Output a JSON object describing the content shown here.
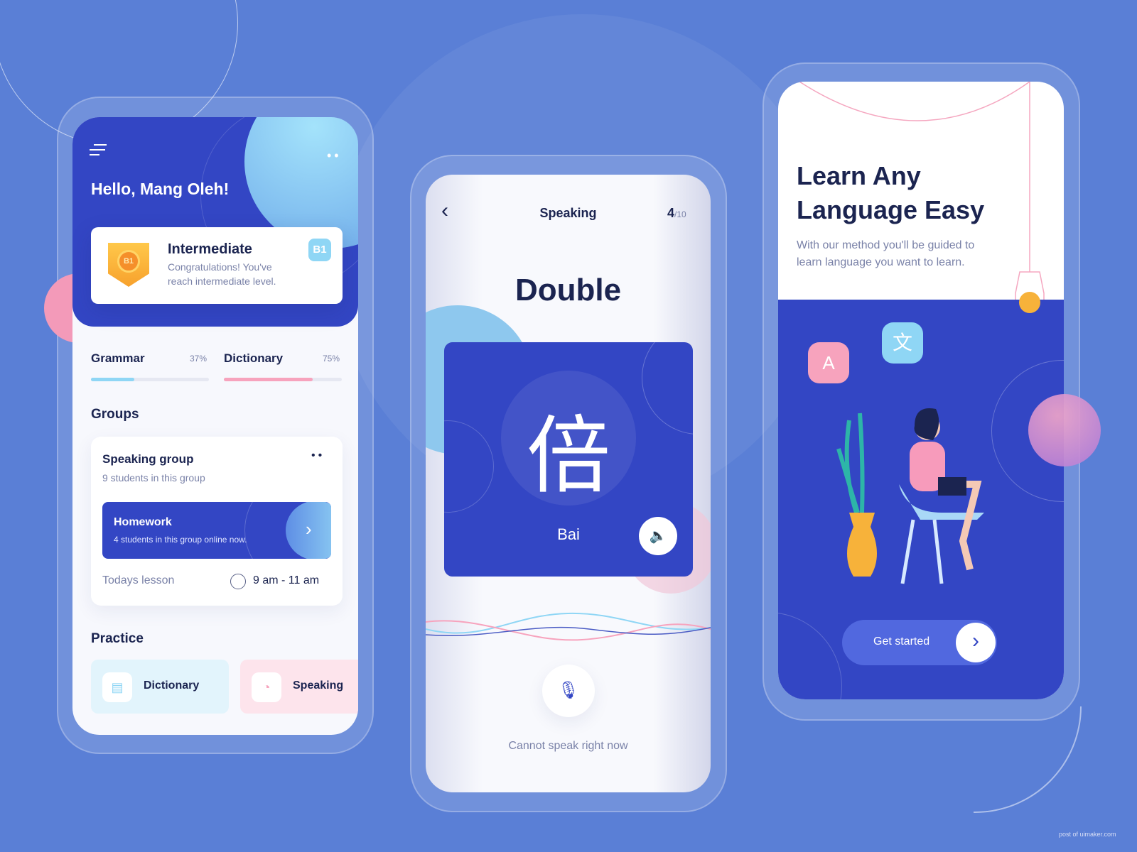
{
  "colors": {
    "background": "#5a7fd6",
    "primary": "#3247c4",
    "accent_blue": "#8fd6f5",
    "accent_pink": "#f7a3bd",
    "badge_gold": "#f7b23a"
  },
  "home": {
    "menu_icon": "menu-icon",
    "more_icon": "more-dots-icon",
    "greeting": "Hello, Mang Oleh!",
    "level_card": {
      "title": "Intermediate",
      "description_line1": "Congratulations! You've",
      "description_line2": "reach intermediate level.",
      "badge": "B1",
      "medal_label": "B1"
    },
    "progress": [
      {
        "label": "Grammar",
        "percent_text": "37%",
        "value": 37,
        "color": "#8fd6f5"
      },
      {
        "label": "Dictionary",
        "percent_text": "75%",
        "value": 75,
        "color": "#f7a3bd"
      }
    ],
    "groups_title": "Groups",
    "group": {
      "name": "Speaking group",
      "subtitle": "9 students in this group",
      "homework_title": "Homework",
      "homework_subtitle": "4 students in this group online now.",
      "lesson_label": "Todays lesson",
      "lesson_time": "9 am - 11 am"
    },
    "practice_title": "Practice",
    "practice": [
      {
        "label": "Dictionary",
        "icon": "book-icon"
      },
      {
        "label": "Speaking",
        "icon": "speaking-icon"
      }
    ]
  },
  "speaking": {
    "title": "Speaking",
    "current": "4",
    "total": "/10",
    "word": "Double",
    "character": "倍",
    "pinyin": "Bai",
    "cannot_speak": "Cannot speak right now"
  },
  "onboarding": {
    "title_line1": "Learn Any",
    "title_line2": "Language Easy",
    "subtitle_line1": "With our method you'll be guided to",
    "subtitle_line2": "learn language you want to learn.",
    "bubble_a": "A",
    "bubble_zh": "文",
    "cta": "Get started"
  },
  "watermark": "post of uimaker.com"
}
